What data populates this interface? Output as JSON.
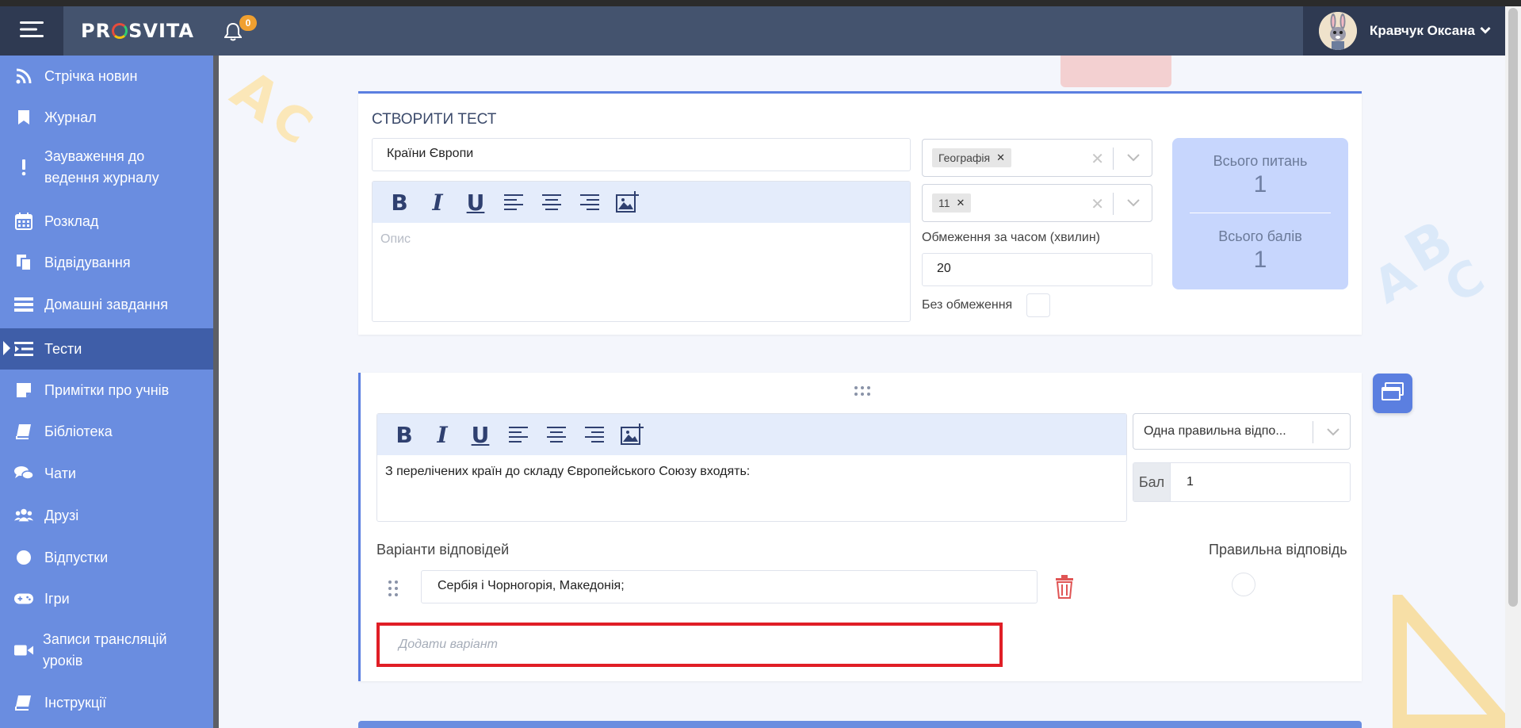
{
  "header": {
    "logo_text_1": "PR",
    "logo_text_2": "SVITA",
    "notification_count": "0",
    "user_name": "Кравчук Оксана"
  },
  "sidebar": {
    "items": [
      {
        "label": "Стрічка новин",
        "icon": "rss-icon"
      },
      {
        "label": "Журнал",
        "icon": "bookmark-icon"
      },
      {
        "label": "Зауваження до\nведення журналу",
        "icon": "exclamation-icon"
      },
      {
        "label": "Розклад",
        "icon": "calendar-icon"
      },
      {
        "label": "Відвідування",
        "icon": "copy-icon"
      },
      {
        "label": "Домашні завдання",
        "icon": "tasks-icon"
      },
      {
        "label": "Тести",
        "icon": "test-list-icon",
        "active": true
      },
      {
        "label": "Примітки про учнів",
        "icon": "sticky-note-icon"
      },
      {
        "label": "Бібліотека",
        "icon": "book-icon"
      },
      {
        "label": "Чати",
        "icon": "chat-icon"
      },
      {
        "label": "Друзі",
        "icon": "users-icon"
      },
      {
        "label": "Відпустки",
        "icon": "circle-icon"
      },
      {
        "label": "Ігри",
        "icon": "gamepad-icon"
      },
      {
        "label": "Записи трансляцій\nуроків",
        "icon": "video-icon"
      },
      {
        "label": "Інструкції",
        "icon": "book-open-icon"
      }
    ]
  },
  "test_form": {
    "title": "СТВОРИТИ ТЕСТ",
    "name_value": "Країни Європи",
    "description_placeholder": "Опис",
    "subject_tag": "Географія",
    "grade_tag": "11",
    "time_limit_label": "Обмеження за часом (хвилин)",
    "time_limit_value": "20",
    "no_limit_label": "Без обмеження",
    "total_questions_label": "Всього питань",
    "total_questions_value": "1",
    "total_points_label": "Всього балів",
    "total_points_value": "1"
  },
  "question": {
    "text": "З перелічених країн до складу Європейського Союзу входять:",
    "type_value": "Одна правильна відпо...",
    "points_label": "Бал",
    "points_value": "1",
    "answers_label": "Варіанти відповідей",
    "correct_label": "Правильна відповідь",
    "answers": [
      {
        "text": "Сербія і Чорногорія, Македонія;"
      }
    ],
    "add_variant_placeholder": "Додати варіант"
  },
  "colors": {
    "sidebar": "#6a8de0",
    "navbar": "#44536e",
    "accent": "#5b7fe0",
    "highlight_border": "#e01e26"
  }
}
